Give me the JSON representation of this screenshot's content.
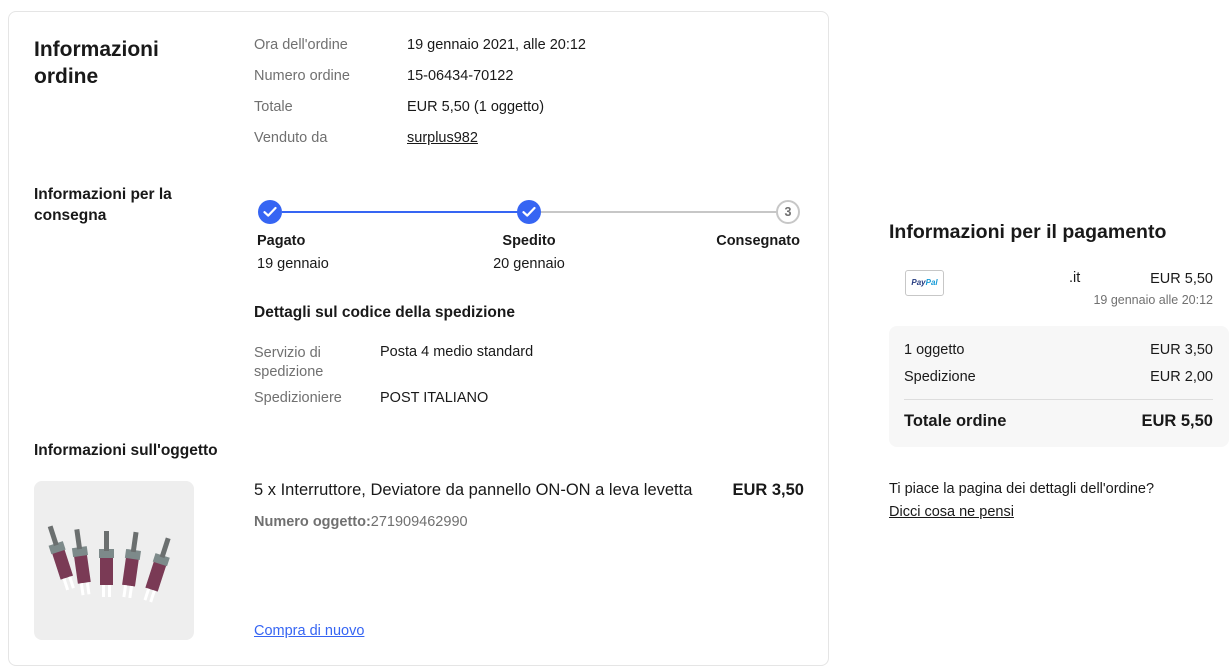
{
  "order_info": {
    "heading": "Informazioni ordine",
    "rows": [
      {
        "label": "Ora dell'ordine",
        "value": "19 gennaio 2021, alle 20:12"
      },
      {
        "label": "Numero ordine",
        "value": "15-06434-70122"
      },
      {
        "label": "Totale",
        "value": "EUR 5,50 (1 oggetto)"
      },
      {
        "label": "Venduto da",
        "value": "surplus982"
      }
    ]
  },
  "delivery": {
    "heading": "Informazioni per la consegna",
    "steps": [
      {
        "title": "Pagato",
        "date": "19 gennaio",
        "status": "done"
      },
      {
        "title": "Spedito",
        "date": "20 gennaio",
        "status": "done"
      },
      {
        "title": "Consegnato",
        "date": "",
        "status": "pending",
        "number": "3"
      }
    ],
    "colors": {
      "done": "#3665f3",
      "pending": "#c7c7c7"
    },
    "tracking_heading": "Dettagli sul codice della spedizione",
    "service_label": "Servizio di spedizione",
    "service_value": "Posta 4 medio standard",
    "carrier_label": "Spedizioniere",
    "carrier_value": "POST ITALIANO"
  },
  "item": {
    "heading": "Informazioni sull'oggetto",
    "title": "5 x Interruttore, Deviatore da pannello ON-ON a leva levetta",
    "price": "EUR 3,50",
    "number_label": "Numero oggetto:",
    "number_value": "271909462990",
    "buy_again": "Compra di nuovo",
    "image_icon": "toggle-switches-photo"
  },
  "payment": {
    "heading": "Informazioni per il pagamento",
    "method_logo_a": "Pay",
    "method_logo_b": "Pal",
    "domain": ".it",
    "amount": "EUR 5,50",
    "date": "19 gennaio alle 20:12",
    "summary": {
      "items_label": "1 oggetto",
      "items_value": "EUR 3,50",
      "shipping_label": "Spedizione",
      "shipping_value": "EUR 2,00",
      "total_label": "Totale ordine",
      "total_value": "EUR 5,50"
    }
  },
  "feedback": {
    "question": "Ti piace la pagina dei dettagli dell'ordine?",
    "link": "Dicci cosa ne pensi"
  }
}
